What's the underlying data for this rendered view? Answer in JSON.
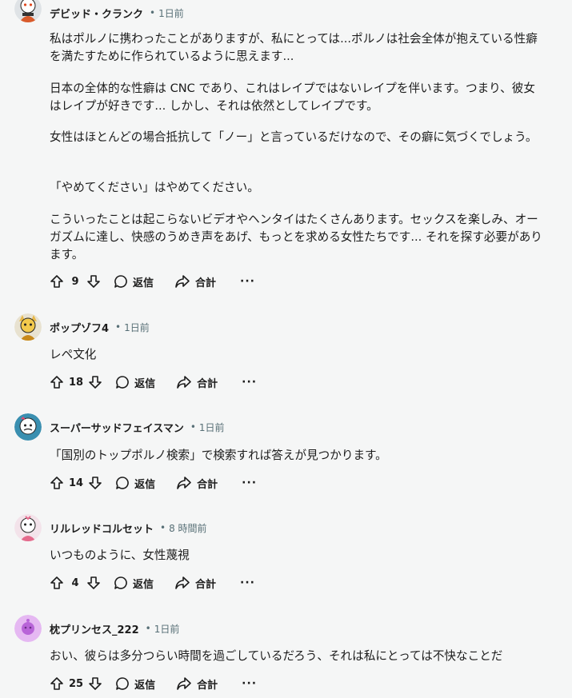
{
  "comments": [
    {
      "author": "デビッド・クランク",
      "time": "1日前",
      "avatar": "snoo-avatar-orange",
      "paragraphs": [
        "私はポルノに携わったことがありますが、私にとっては...ポルノは社会全体が抱えている性癖を満たすために作られているように思えます...",
        "日本の全体的な性癖は CNC であり、これはレイプではないレイプを伴います。つまり、彼女はレイプが好きです... しかし、それは依然としてレイプです。",
        "女性はほとんどの場合抵抗して「ノー」と言っているだけなので、その癖に気づくでしょう。",
        "「やめてください」はやめてください。",
        "こういったことは起こらないビデオやヘンタイはたくさんあります。セックスを楽しみ、オーガズムに達し、快感のうめき声をあげ、もっとを求める女性たちです... それを探す必要があります。"
      ],
      "votes": "9",
      "reply_label": "返信",
      "share_label": "合計",
      "more": "···"
    },
    {
      "author": "ポップゾフ4",
      "time": "1日前",
      "avatar": "snoo-avatar-yellow",
      "paragraphs": [
        "レペ文化"
      ],
      "votes": "18",
      "reply_label": "返信",
      "share_label": "合計",
      "more": "···"
    },
    {
      "author": "スーパーサッドフェイスマン",
      "time": "1日前",
      "avatar": "snoo-avatar-blue",
      "paragraphs": [
        "「国別のトップポルノ検索」で検索すれば答えが見つかります。"
      ],
      "votes": "14",
      "reply_label": "返信",
      "share_label": "合計",
      "more": "···"
    },
    {
      "author": "リルレッドコルセット",
      "time": "8 時間前",
      "avatar": "snoo-avatar-pink",
      "paragraphs": [
        "いつものように、女性蔑視"
      ],
      "votes": "4",
      "reply_label": "返信",
      "share_label": "合計",
      "more": "···"
    },
    {
      "author": "枕プリンセス_222",
      "time": "1日前",
      "avatar": "snoo-avatar-purple",
      "paragraphs": [
        "おい、彼らは多分つらい時間を過ごしているだろう、それは私にとっては不快なことだ"
      ],
      "votes": "25",
      "reply_label": "返信",
      "share_label": "合計",
      "more": "···"
    }
  ],
  "colors": {
    "background": "#f5f6f6",
    "text": "#1c1c1c",
    "meta_text": "#576f76"
  }
}
